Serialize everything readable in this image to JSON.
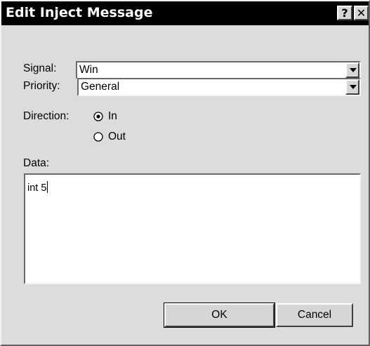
{
  "window": {
    "title": "Edit Inject Message",
    "help_glyph": "?",
    "close_glyph": "✕"
  },
  "signal": {
    "label": "Signal:",
    "value": "Win"
  },
  "priority": {
    "label": "Priority:",
    "value": "General"
  },
  "direction": {
    "label": "Direction:",
    "options": [
      {
        "label": "In",
        "selected": true
      },
      {
        "label": "Out",
        "selected": false
      }
    ]
  },
  "data_field": {
    "label": "Data:",
    "value": "int 5"
  },
  "buttons": {
    "ok_label": "OK",
    "cancel_label": "Cancel"
  },
  "colors": {
    "titlebar": "#000000",
    "title_text": "#ffffff",
    "dialog_face": "#dcdcdc",
    "field_bg": "#ffffff"
  },
  "icons": {
    "dropdown": "chevron-down-icon",
    "radio_selected": "radio-selected-icon",
    "radio_unselected": "radio-unselected-icon"
  }
}
